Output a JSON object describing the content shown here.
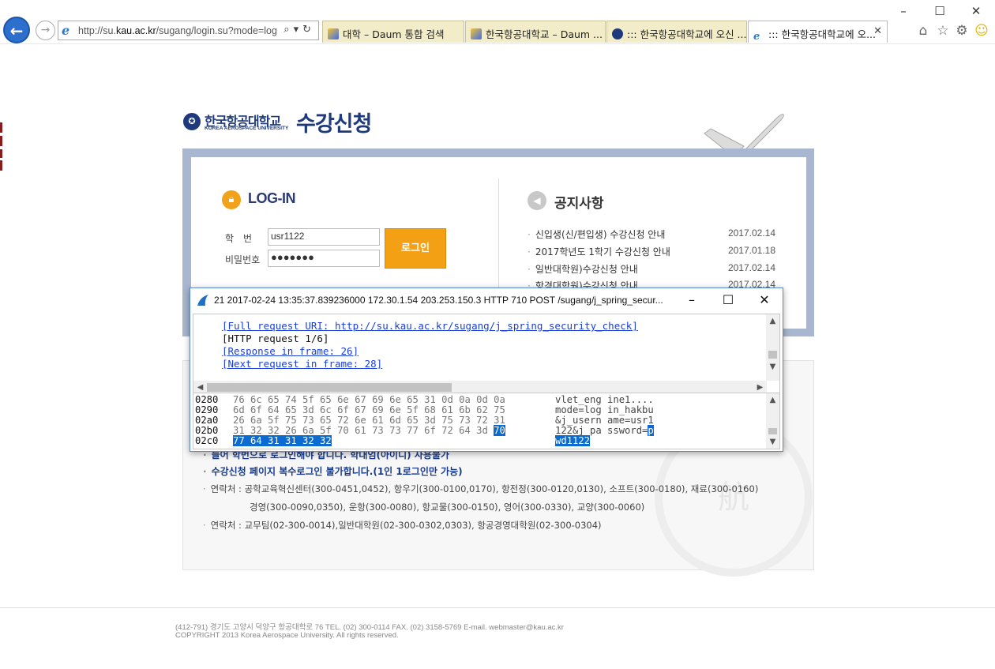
{
  "browser": {
    "address_url": "http://su.kau.ac.kr/sugang/login.su?mode=log",
    "tabs": [
      {
        "label": "대학 – Daum 통합 검색",
        "active": false
      },
      {
        "label": "한국항공대학교 – Daum ...",
        "active": false
      },
      {
        "label": "::: 한국항공대학교에 오신 ...",
        "active": false
      },
      {
        "label": "::: 한국항공대학교에 오...",
        "active": true
      }
    ]
  },
  "page": {
    "logo_korean": "한국항공대학교",
    "logo_english": "KOREA AEROSPACE UNIVERSITY",
    "title": "수강신청",
    "login": {
      "heading": "LOG-IN",
      "id_label": "학　번",
      "id_value": "usr1122",
      "pw_label": "비밀번호",
      "pw_value": "●●●●●●●",
      "button": "로그인"
    },
    "notice": {
      "heading": "공지사항",
      "items": [
        {
          "title": "신입생(신/편입생) 수강신청 안내",
          "date": "2017.02.14"
        },
        {
          "title": "2017학년도 1학기 수강신청 안내",
          "date": "2017.01.18"
        },
        {
          "title": "일반대학원)수강신청 안내",
          "date": "2017.02.14"
        },
        {
          "title": "항경대학원)수강신청 안내",
          "date": "2017.02.14"
        }
      ]
    },
    "info": {
      "line1": "들어 학번으로 로그인해야 합니다. 학대엄(아이디) 사용불가",
      "line2": "수강신청 페이지 복수로그인 불가합니다.(1인 1로그인만 가능)",
      "line3": "연락처 : 공학교육혁신센터(300-0451,0452), 항우기(300-0100,0170), 항전정(300-0120,0130), 소프트(300-0180), 재료(300-0160)",
      "line4": "경영(300-0090,0350), 운항(300-0080), 항교물(300-0150), 영어(300-0330), 교양(300-0060)",
      "line5": "연락처 : 교무팀(02-300-0014),일반대학원(02-300-0302,0303), 항공경영대학원(02-300-0304)"
    },
    "footer": {
      "address": "(412-791) 경기도 고양시 덕양구 항공대학로 76 TEL. (02) 300-0114  FAX. (02) 3158-5769  E-mail. webmaster@kau.ac.kr",
      "copyright": "COPYRIGHT 2013 Korea Aerospace University. All rights reserved."
    }
  },
  "wireshark": {
    "title": "21 2017-02-24 13:35:37.839236000 172.30.1.54 203.253.150.3 HTTP 710 POST /sugang/j_spring_secur...",
    "tree": [
      {
        "text": "[Full request URI: http://su.kau.ac.kr/sugang/j_spring_security_check]",
        "link": true
      },
      {
        "text": "[HTTP request 1/6]",
        "link": false
      },
      {
        "text": "[Response in frame: 26]",
        "link": true
      },
      {
        "text": "[Next request in frame: 28]",
        "link": true
      }
    ],
    "hex": [
      {
        "offset": "0280",
        "hex": "76 6c 65 74 5f 65 6e 67  69 6e 65 31 0d 0a 0d 0a",
        "ascii": "vlet_eng ine1...."
      },
      {
        "offset": "0290",
        "hex": "6d 6f 64 65 3d 6c 6f 67  69 6e 5f 68 61 6b 62 75",
        "ascii": "mode=log in_hakbu"
      },
      {
        "offset": "02a0",
        "hex": "26 6a 5f 75 73 65 72 6e  61 6d 65 3d 75 73 72 31",
        "ascii": "&j_usern ame=usr1"
      },
      {
        "offset": "02b0",
        "hex_plain": "31 32 32 26 6a 5f 70 61  73 73 77 6f 72 64 3d ",
        "hex_sel": "70",
        "ascii_plain": "122&j_pa ssword=",
        "ascii_sel": "p"
      },
      {
        "offset": "02c0",
        "hex_sel": "77 64 31 31 32 32",
        "ascii_sel": "wd1122"
      }
    ]
  },
  "colors": {
    "brand": "#1e3a7c",
    "accent": "#f3a014",
    "selection": "#0b6bd1",
    "link": "#1a3fd8"
  }
}
